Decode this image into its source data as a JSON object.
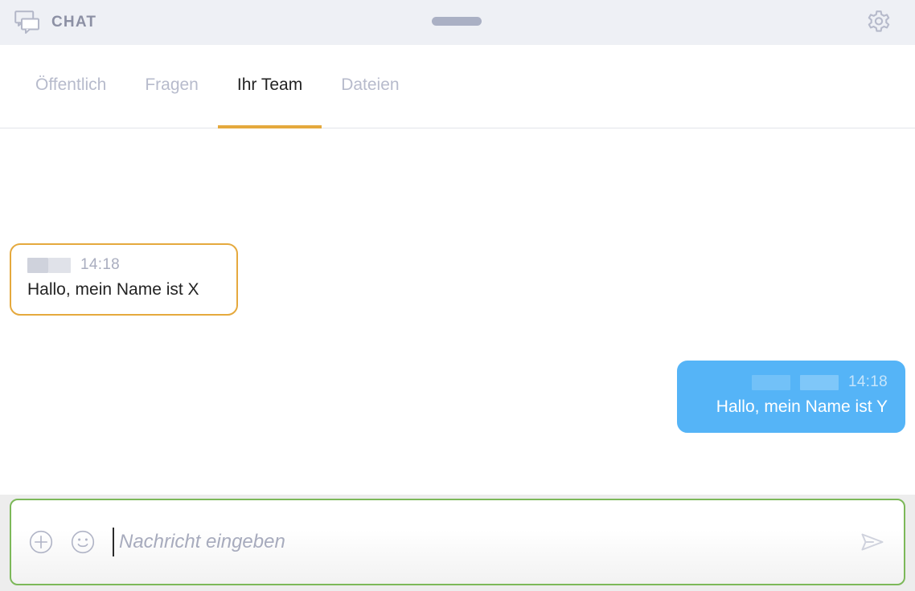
{
  "window": {
    "title": "CHAT",
    "app_icon": "chat-bubbles-icon",
    "settings_icon": "gear-icon",
    "drag_handle": "window-drag-handle"
  },
  "tabs": {
    "items": [
      {
        "label": "Öffentlich",
        "active": false
      },
      {
        "label": "Fragen",
        "active": false
      },
      {
        "label": "Ihr Team",
        "active": true
      },
      {
        "label": "Dateien",
        "active": false
      }
    ],
    "active_underline_color": "#e5a93d"
  },
  "messages": [
    {
      "direction": "incoming",
      "sender": "[redacted]",
      "time": "14:18",
      "text": "Hallo, mein Name ist X",
      "border_color": "#e5a93d",
      "background": "#ffffff"
    },
    {
      "direction": "outgoing",
      "sender": "[redacted]",
      "time": "14:18",
      "text": "Hallo, mein Name ist Y",
      "border_color": "#55b4f7",
      "background": "#55b4f7"
    }
  ],
  "composer": {
    "attach_icon": "plus-circle-icon",
    "emoji_icon": "smiley-icon",
    "send_icon": "send-paper-plane-icon",
    "placeholder": "Nachricht eingeben",
    "value": "",
    "border_color": "#7cb859"
  },
  "colors": {
    "header_background": "#eef0f5",
    "accent_orange": "#e5a93d",
    "accent_blue": "#55b4f7",
    "accent_green": "#7cb859",
    "muted_text": "#b7bbcc"
  }
}
